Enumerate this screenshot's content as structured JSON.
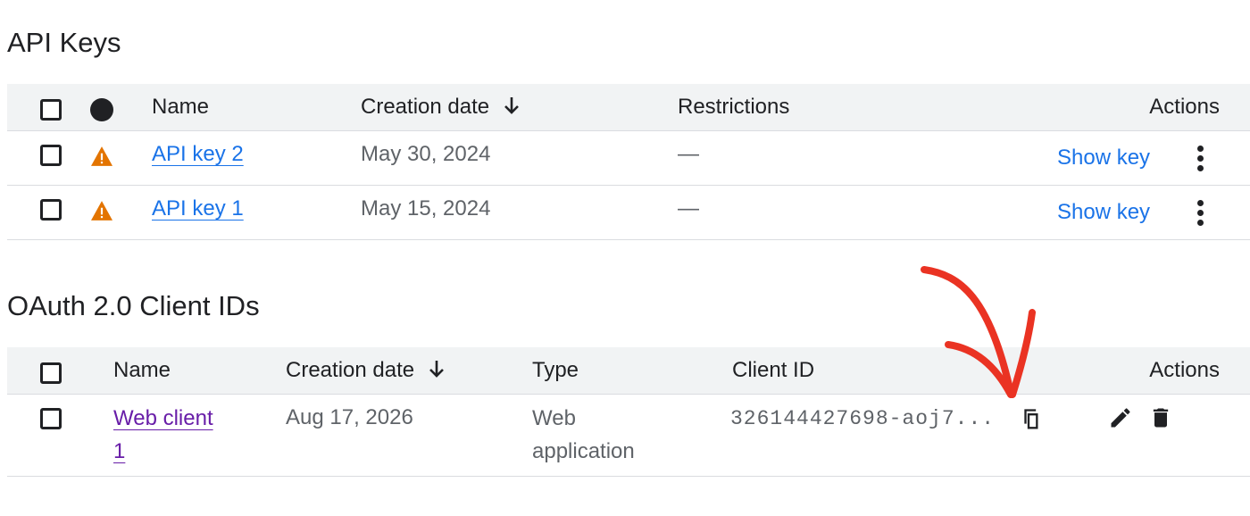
{
  "api_keys": {
    "title": "API Keys",
    "headers": {
      "name": "Name",
      "creation_date": "Creation date",
      "restrictions": "Restrictions",
      "actions": "Actions"
    },
    "rows": [
      {
        "name": "API key 2",
        "date": "May 30, 2024",
        "restrictions": "—",
        "action": "Show key"
      },
      {
        "name": "API key 1",
        "date": "May 15, 2024",
        "restrictions": "—",
        "action": "Show key"
      }
    ]
  },
  "oauth": {
    "title": "OAuth 2.0 Client IDs",
    "headers": {
      "name": "Name",
      "creation_date": "Creation date",
      "type": "Type",
      "client_id": "Client ID",
      "actions": "Actions"
    },
    "rows": [
      {
        "name_line1": "Web client",
        "name_line2": "1",
        "date": "Aug 17, 2026",
        "type_line1": "Web",
        "type_line2": "application",
        "client_id": "326144427698-aoj7..."
      }
    ]
  },
  "colors": {
    "link": "#1a73e8",
    "visited_link": "#681da8",
    "warning": "#e37400",
    "annotation": "#ea3323",
    "header_bg": "#f1f3f4"
  },
  "icons": {
    "sort": "arrow-down-icon",
    "warning": "warning-icon",
    "status": "status-dot-icon",
    "more": "more-vert-icon",
    "copy": "copy-icon",
    "edit": "edit-icon",
    "delete": "delete-icon"
  }
}
